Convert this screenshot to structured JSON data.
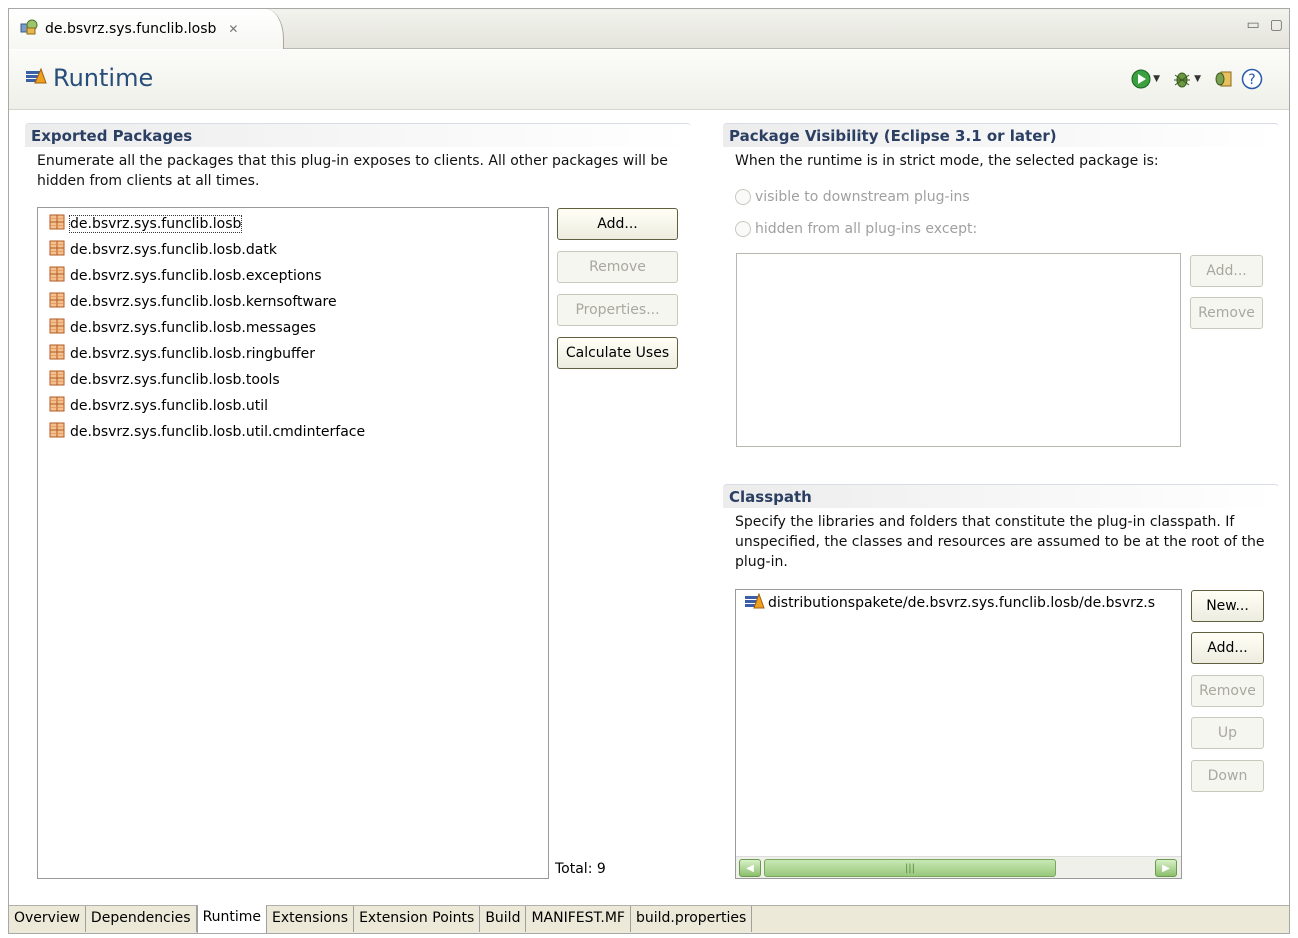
{
  "editor_tab": {
    "title": "de.bsvrz.sys.funclib.losb",
    "close": "✕"
  },
  "view_controls": {
    "minimize": "▭",
    "maximize": "▢"
  },
  "header": {
    "title": "Runtime"
  },
  "exported": {
    "title": "Exported Packages",
    "description": "Enumerate all the packages that this plug-in exposes to clients.  All other packages will be hidden from clients at all times.",
    "packages": [
      "de.bsvrz.sys.funclib.losb",
      "de.bsvrz.sys.funclib.losb.datk",
      "de.bsvrz.sys.funclib.losb.exceptions",
      "de.bsvrz.sys.funclib.losb.kernsoftware",
      "de.bsvrz.sys.funclib.losb.messages",
      "de.bsvrz.sys.funclib.losb.ringbuffer",
      "de.bsvrz.sys.funclib.losb.tools",
      "de.bsvrz.sys.funclib.losb.util",
      "de.bsvrz.sys.funclib.losb.util.cmdinterface"
    ],
    "buttons": {
      "add": "Add...",
      "remove": "Remove",
      "properties": "Properties...",
      "calculate": "Calculate Uses"
    },
    "total": "Total: 9"
  },
  "visibility": {
    "title": "Package Visibility (Eclipse 3.1 or later)",
    "description": "When the runtime is in strict mode, the selected package is:",
    "option_visible": "visible to downstream plug-ins",
    "option_hidden": "hidden from all plug-ins except:",
    "buttons": {
      "add": "Add...",
      "remove": "Remove"
    }
  },
  "classpath": {
    "title": "Classpath",
    "description": "Specify the libraries and folders that constitute the plug-in classpath.  If unspecified, the classes and resources are assumed to be at the root of the plug-in.",
    "entries": [
      "distributionspakete/de.bsvrz.sys.funclib.losb/de.bsvrz.s"
    ],
    "buttons": {
      "new": "New...",
      "add": "Add...",
      "remove": "Remove",
      "up": "Up",
      "down": "Down"
    }
  },
  "page_tabs": [
    "Overview",
    "Dependencies",
    "Runtime",
    "Extensions",
    "Extension Points",
    "Build",
    "MANIFEST.MF",
    "build.properties"
  ],
  "active_tab": "Runtime",
  "colors": {
    "title": "#274e7a",
    "section_title": "#2b3f63",
    "accent_green": "#8cbf6c"
  }
}
